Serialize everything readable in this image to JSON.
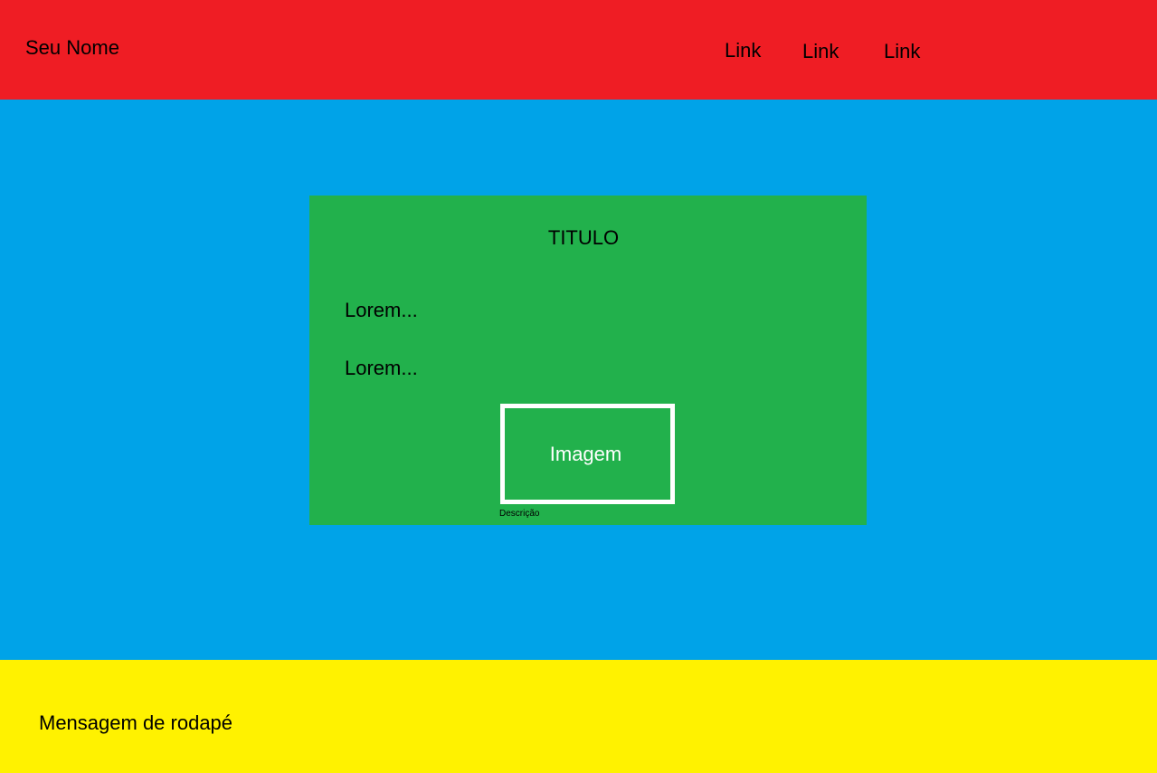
{
  "header": {
    "site_name": "Seu Nome",
    "links": [
      {
        "label": "Link"
      },
      {
        "label": "Link"
      },
      {
        "label": "Link"
      }
    ]
  },
  "main": {
    "card": {
      "title": "TITULO",
      "paragraphs": [
        "Lorem...",
        "Lorem..."
      ],
      "image": {
        "label": "Imagem",
        "caption": "Descrição"
      }
    }
  },
  "footer": {
    "message": "Mensagem de rodapé"
  },
  "colors": {
    "header_bg": "#ef1d24",
    "main_bg": "#00a3e8",
    "card_bg": "#22b14c",
    "image_border": "#ffffff",
    "footer_bg": "#fff200"
  }
}
